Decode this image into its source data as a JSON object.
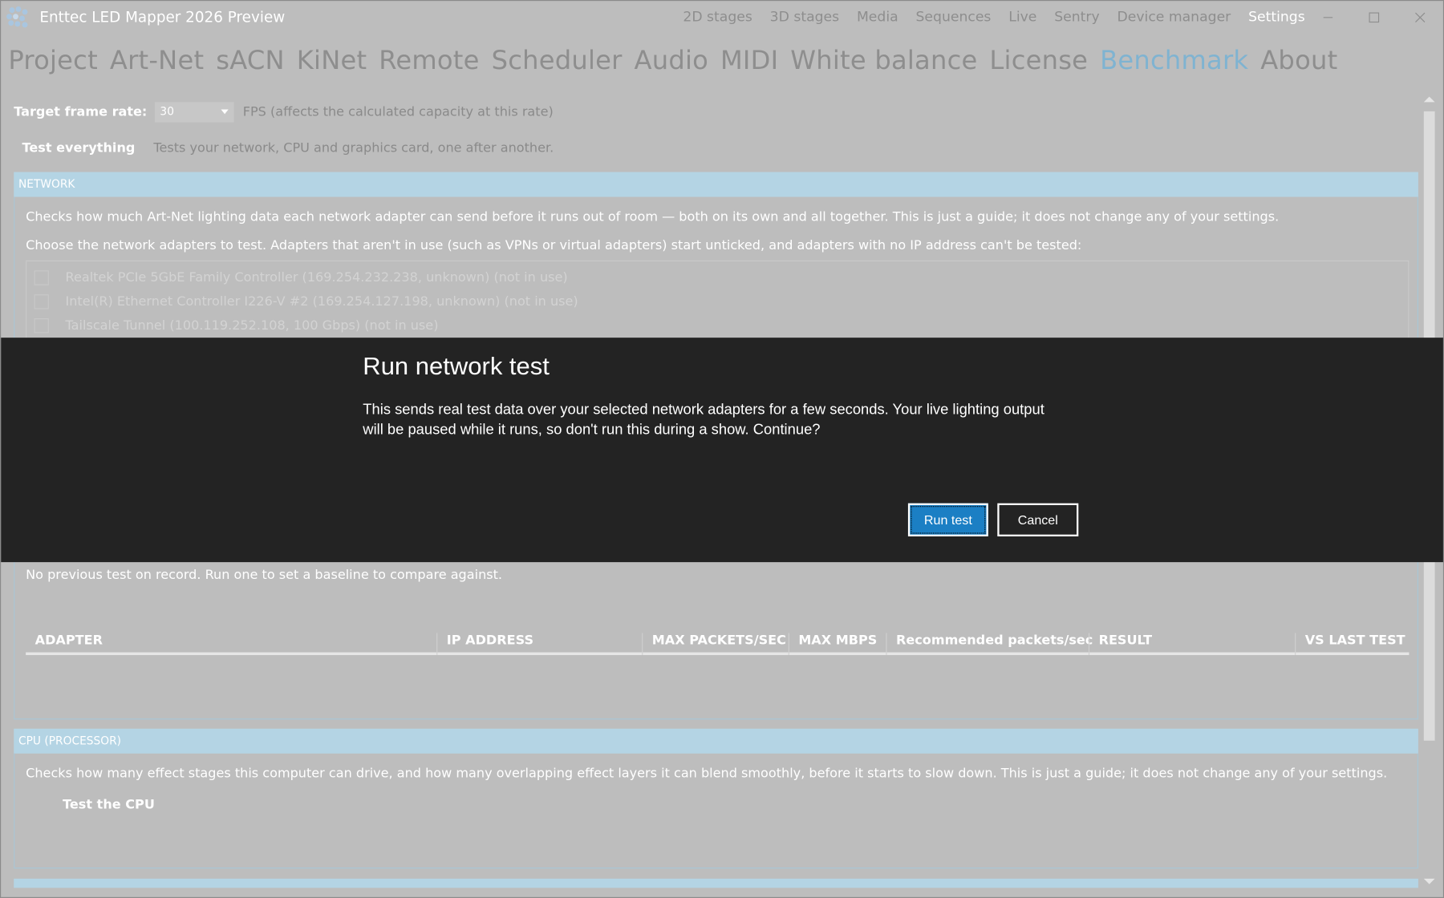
{
  "window": {
    "title": "Enttec LED Mapper 2026 Preview",
    "top_nav": [
      "2D stages",
      "3D stages",
      "Media",
      "Sequences",
      "Live",
      "Sentry",
      "Device manager",
      "Settings"
    ],
    "active_top_nav": "Settings",
    "controls": {
      "minimize": "—",
      "maximize": "☐",
      "close": "✕"
    }
  },
  "settings_tabs": [
    "Project",
    "Art-Net",
    "sACN",
    "KiNet",
    "Remote",
    "Scheduler",
    "Audio",
    "MIDI",
    "White balance",
    "License",
    "Benchmark",
    "About"
  ],
  "active_tab": "Benchmark",
  "frame_rate": {
    "label": "Target frame rate:",
    "value": "30",
    "hint": "FPS (affects the calculated capacity at this rate)"
  },
  "test_everything": {
    "button": "Test everything",
    "hint": "Tests your network, CPU and graphics card, one after another."
  },
  "network": {
    "heading": "NETWORK",
    "description": "Checks how much Art-Net lighting data each network adapter can send before it runs out of room — both on its own and all together. This is just a guide; it does not change any of your settings.",
    "choose_text": "Choose the network adapters to test. Adapters that aren't in use (such as VPNs or virtual adapters) start unticked, and adapters with no IP address can't be tested:",
    "adapters": [
      {
        "label": "Realtek PCIe 5GbE Family Controller  (169.254.232.238, unknown)  (not in use)",
        "checked": false
      },
      {
        "label": "Intel(R) Ethernet Controller I226-V #2  (169.254.127.198, unknown)  (not in use)",
        "checked": false
      },
      {
        "label": "Tailscale Tunnel  (100.119.252.108, 100 Gbps)  (not in use)",
        "checked": false
      }
    ],
    "previous_test": "No previous test on record. Run one to set a baseline to compare against.",
    "table_columns": [
      "ADAPTER",
      "IP ADDRESS",
      "MAX PACKETS/SEC",
      "MAX MBPS",
      "Recommended packets/sec",
      "RESULT",
      "VS LAST TEST"
    ]
  },
  "cpu": {
    "heading": "CPU (PROCESSOR)",
    "description": "Checks how many effect stages this computer can drive, and how many overlapping effect layers it can blend smoothly, before it starts to slow down. This is just a guide; it does not change any of your settings.",
    "button": "Test the CPU"
  },
  "dialog": {
    "title": "Run network test",
    "line1": "This sends real test data over your selected network adapters for a few seconds. Your live lighting output",
    "line2": "will be paused while it runs, so don't run this during a show. Continue?",
    "confirm": "Run test",
    "cancel": "Cancel"
  },
  "colors": {
    "accent_tab": "#7fb3d1",
    "section_header": "#b4d4e4",
    "dialog_bg": "#232323",
    "primary_button": "#1b7fc4"
  }
}
